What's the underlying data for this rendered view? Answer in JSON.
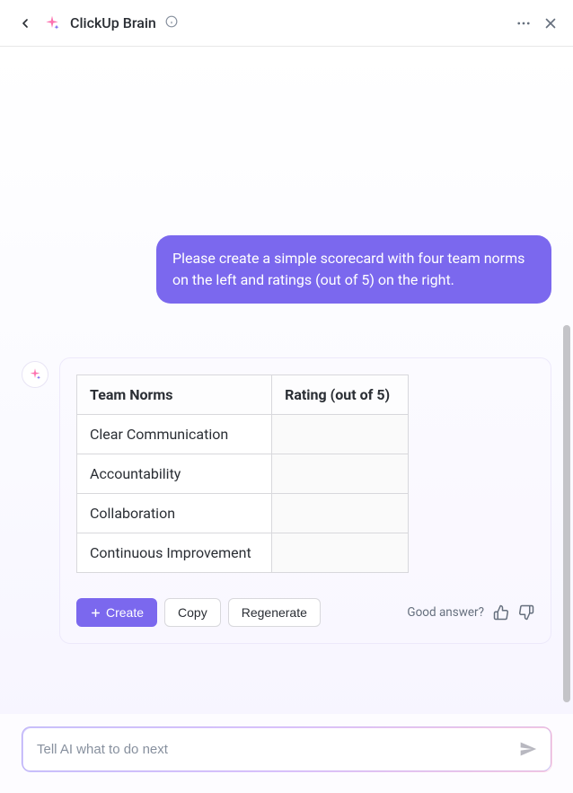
{
  "header": {
    "title": "ClickUp Brain"
  },
  "user_message": "Please create a simple scorecard with four team norms on the left and ratings (out of 5) on the right.",
  "table": {
    "headers": [
      "Team Norms",
      "Rating (out of 5)"
    ],
    "rows": [
      {
        "norm": "Clear Communication",
        "rating": ""
      },
      {
        "norm": "Accountability",
        "rating": ""
      },
      {
        "norm": "Collaboration",
        "rating": ""
      },
      {
        "norm": "Continuous Improvement",
        "rating": ""
      }
    ]
  },
  "actions": {
    "create": "Create",
    "copy": "Copy",
    "regenerate": "Regenerate"
  },
  "feedback": {
    "label": "Good answer?"
  },
  "input": {
    "placeholder": "Tell AI what to do next"
  },
  "colors": {
    "primary": "#7b68ee",
    "accent_pink": "#fd71af",
    "text": "#2a2e34",
    "muted": "#656f7d"
  }
}
